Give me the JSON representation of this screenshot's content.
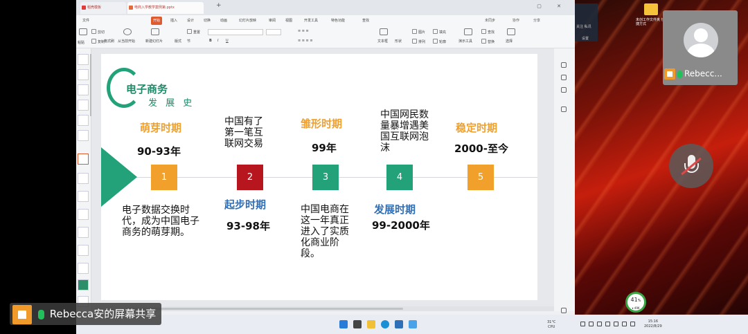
{
  "window": {
    "tab1_label": "稻壳模板",
    "tab2_label": "电商入学教学案例第.pptx",
    "new_tab": "+",
    "win_controls": "▢ ✕"
  },
  "menu": {
    "items": [
      "文件",
      "开始",
      "插入",
      "设计",
      "切换",
      "动画",
      "幻灯片放映",
      "审阅",
      "视图",
      "开发工具",
      "特色功能",
      "查找"
    ],
    "active": "开始",
    "right_items": [
      "未同步",
      "协作",
      "分享"
    ]
  },
  "ribbon": {
    "cut": "剪切",
    "copy": "复制",
    "paste": "粘贴",
    "format_painter": "格式刷",
    "from_current": "从当前开始",
    "new_slide": "新建幻灯片",
    "layout": "版式",
    "section": "节",
    "reset": "重置",
    "textbox": "文本框",
    "shape": "形状",
    "arrange": "排列",
    "picture": "图片",
    "fill": "填充",
    "outline": "轮廓",
    "presentation_tools": "演示工具",
    "find": "查找",
    "replace": "替换",
    "select": "选择"
  },
  "slide": {
    "title_main": "电子商务",
    "title_sub": "发 展 史",
    "stages": [
      {
        "number": "1",
        "phase": "萌芽时期",
        "years": "90-93年",
        "desc": "电子数据交换时代，成为中国电子商务的萌芽期。",
        "color": "#f0a02b"
      },
      {
        "number": "2",
        "phase": "起步时期",
        "years": "93-98年",
        "desc": "中国有了第一笔互联网交易",
        "color": "#b8161f"
      },
      {
        "number": "3",
        "phase": "雏形时期",
        "years": "99年",
        "desc": "中国电商在这一年真正进入了实质化商业阶段。",
        "color": "#23a27a"
      },
      {
        "number": "4",
        "phase": "发展时期",
        "years": "99-2000年",
        "desc": "中国网民数量暴增遇美国互联网泡沫",
        "color": "#23a27a"
      },
      {
        "number": "5",
        "phase": "稳定时期",
        "years": "2000-至今",
        "desc": "",
        "color": "#f0a02b"
      }
    ]
  },
  "taskbar": {
    "weather": "31°C",
    "cpu": "CPU",
    "time": "15:16",
    "date": "2022/8/29"
  },
  "meeting": {
    "participant_name": "Rebecc...",
    "share_label": "Rebecca安的屏幕共享",
    "speed_value": "41",
    "speed_unit": "%",
    "speed_sub": "▾ 49K"
  },
  "desktop": {
    "folder_label": "未创工作文件夹  快捷方式"
  },
  "notif": {
    "line1": "关注 私讯",
    "line2": "设置"
  }
}
